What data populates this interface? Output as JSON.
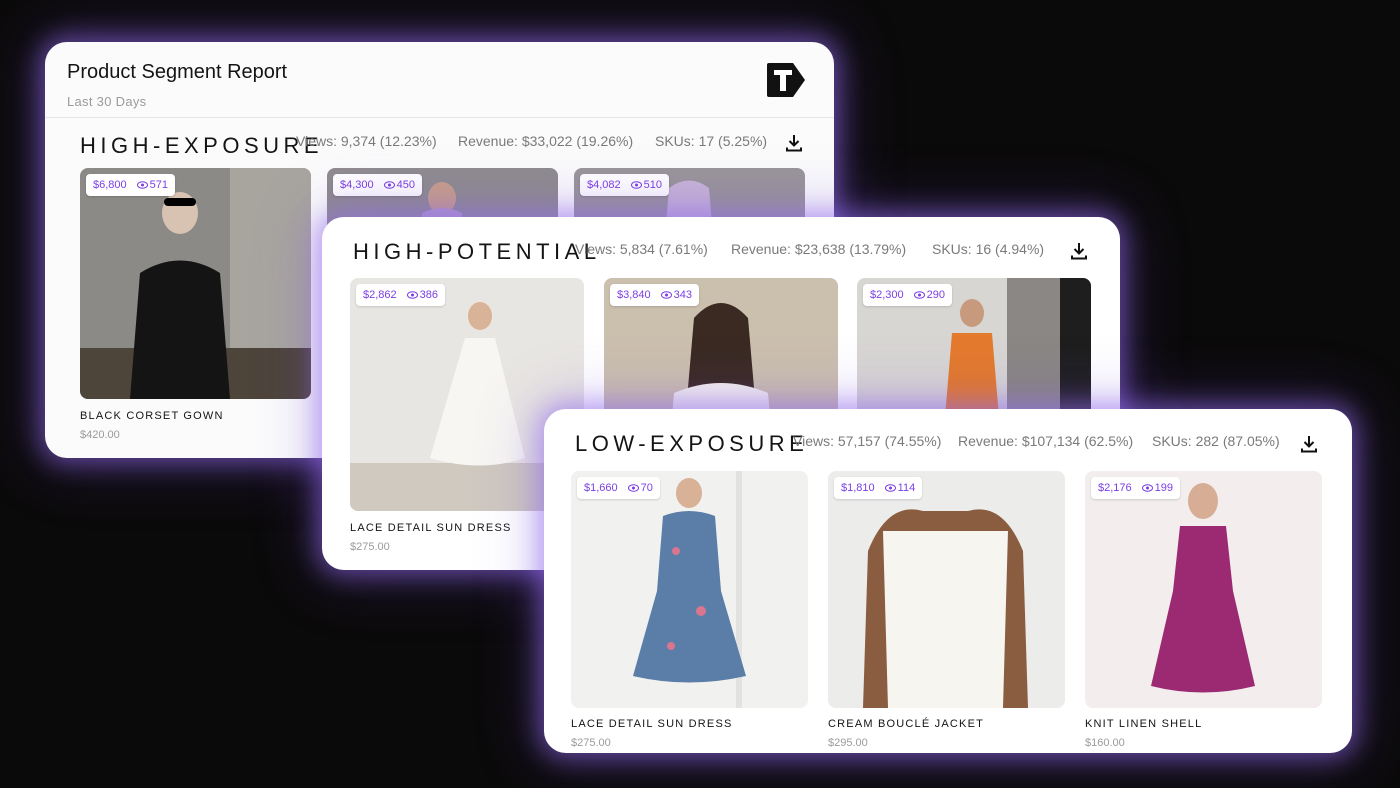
{
  "report": {
    "title": "Product Segment Report",
    "subtitle": "Last 30 Days",
    "logo_icon": "brand-t-logo"
  },
  "accent_color": "#7b3fe4",
  "segments": [
    {
      "key": "high_exposure",
      "title": "HIGH-EXPOSURE",
      "views": "Views: 9,374 (12.23%)",
      "revenue": "Revenue: $33,022 (19.26%)",
      "skus": "SKUs: 17 (5.25%)",
      "products": [
        {
          "revenue": "$6,800",
          "views": "571",
          "name": "BLACK CORSET GOWN",
          "price": "$420.00"
        },
        {
          "revenue": "$4,300",
          "views": "450",
          "name": "",
          "price": ""
        },
        {
          "revenue": "$4,082",
          "views": "510",
          "name": "",
          "price": ""
        }
      ]
    },
    {
      "key": "high_potential",
      "title": "HIGH-POTENTIAL",
      "views": "Views: 5,834 (7.61%)",
      "revenue": "Revenue: $23,638 (13.79%)",
      "skus": "SKUs: 16 (4.94%)",
      "products": [
        {
          "revenue": "$2,862",
          "views": "386",
          "name": "LACE DETAIL SUN DRESS",
          "price": "$275.00"
        },
        {
          "revenue": "$3,840",
          "views": "343",
          "name": "",
          "price": ""
        },
        {
          "revenue": "$2,300",
          "views": "290",
          "name": "",
          "price": ""
        }
      ]
    },
    {
      "key": "low_exposure",
      "title": "LOW-EXPOSURE",
      "views": "Views: 57,157 (74.55%)",
      "revenue": "Revenue: $107,134 (62.5%)",
      "skus": "SKUs: 282 (87.05%)",
      "products": [
        {
          "revenue": "$1,660",
          "views": "70",
          "name": "LACE DETAIL SUN DRESS",
          "price": "$275.00"
        },
        {
          "revenue": "$1,810",
          "views": "114",
          "name": "CREAM BOUCLÉ JACKET",
          "price": "$295.00"
        },
        {
          "revenue": "$2,176",
          "views": "199",
          "name": "KNIT LINEN SHELL",
          "price": "$160.00"
        }
      ]
    }
  ]
}
